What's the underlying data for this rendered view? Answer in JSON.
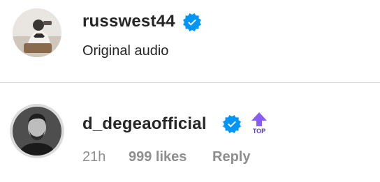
{
  "post": {
    "username": "russwest44",
    "verified": true,
    "audio": "Original audio"
  },
  "comment": {
    "username": "d_degeaofficial",
    "verified": true,
    "top_badge_label": "TOP",
    "time": "21h",
    "likes": "999 likes",
    "reply_label": "Reply"
  },
  "icons": {
    "verified": "verified-badge-icon",
    "top": "top-arrow-icon"
  },
  "colors": {
    "verified_blue": "#0095f6",
    "top_purple": "#8a5cf6",
    "text_primary": "#262626",
    "text_secondary": "#8e8e8e",
    "divider": "#dbdbdb"
  }
}
